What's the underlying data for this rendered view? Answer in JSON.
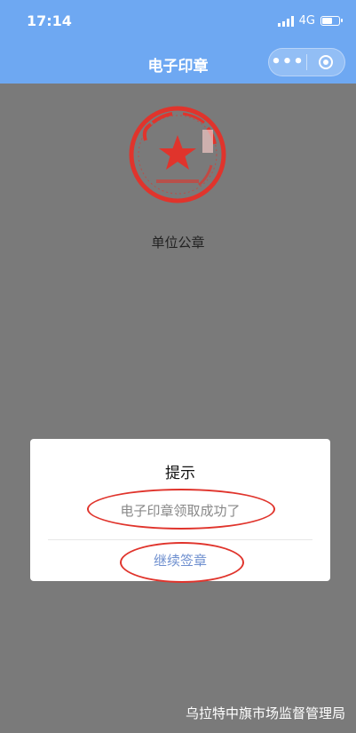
{
  "status_bar": {
    "time": "17:14",
    "network": "4G"
  },
  "nav": {
    "title": "电子印章",
    "more_glyph": "•••"
  },
  "seal": {
    "caption": "单位公章",
    "color": "#e0342c"
  },
  "dialog": {
    "title": "提示",
    "message": "电子印章领取成功了",
    "button_label": "继续签章",
    "button_color": "#6e8fcf",
    "highlight_color": "#e0342c"
  },
  "footer": {
    "org_label": "乌拉特中旗市场监督管理局"
  },
  "icons": {
    "signal": "signal-icon",
    "battery": "battery-icon",
    "more": "more-dots-icon",
    "close_target": "target-icon",
    "star": "star-icon"
  }
}
